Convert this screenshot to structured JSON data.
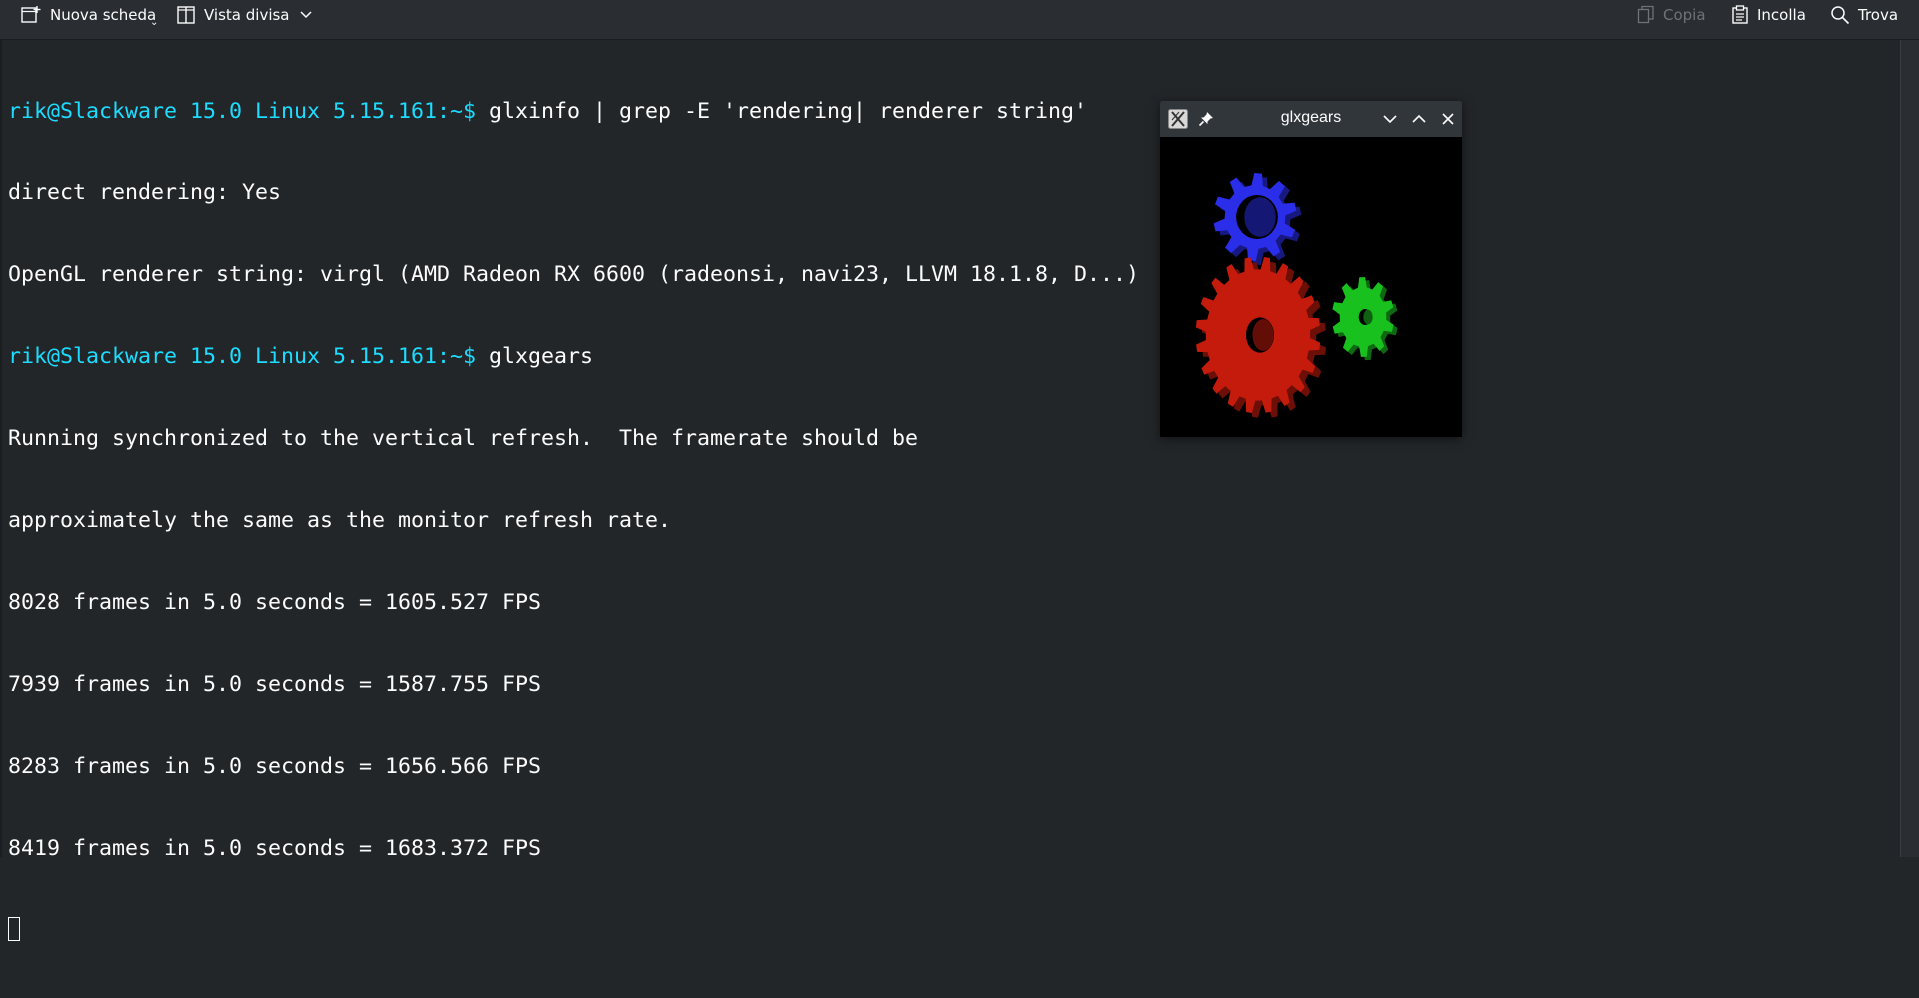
{
  "toolbar": {
    "new_tab_label": "Nuova scheda",
    "split_view_label": "Vista divisa",
    "copy_label": "Copia",
    "paste_label": "Incolla",
    "find_label": "Trova"
  },
  "terminal": {
    "lines": [
      {
        "prompt": "rik@Slackware 15.0 Linux 5.15.161:~$ ",
        "text": "glxinfo | grep -E 'rendering| renderer string'"
      },
      {
        "prompt": "",
        "text": "direct rendering: Yes"
      },
      {
        "prompt": "",
        "text": "OpenGL renderer string: virgl (AMD Radeon RX 6600 (radeonsi, navi23, LLVM 18.1.8, D...)"
      },
      {
        "prompt": "rik@Slackware 15.0 Linux 5.15.161:~$ ",
        "text": "glxgears"
      },
      {
        "prompt": "",
        "text": "Running synchronized to the vertical refresh.  The framerate should be"
      },
      {
        "prompt": "",
        "text": "approximately the same as the monitor refresh rate."
      },
      {
        "prompt": "",
        "text": "8028 frames in 5.0 seconds = 1605.527 FPS"
      },
      {
        "prompt": "",
        "text": "7939 frames in 5.0 seconds = 1587.755 FPS"
      },
      {
        "prompt": "",
        "text": "8283 frames in 5.0 seconds = 1656.566 FPS"
      },
      {
        "prompt": "",
        "text": "8419 frames in 5.0 seconds = 1683.372 FPS"
      }
    ]
  },
  "glxgears_window": {
    "title": "glxgears",
    "gear_colors": {
      "red": "#c41b0c",
      "green": "#19c11f",
      "blue": "#2a2ee8"
    }
  },
  "colors": {
    "background": "#232629",
    "prompt": "#1cdcff",
    "text": "#fcfcfc"
  }
}
